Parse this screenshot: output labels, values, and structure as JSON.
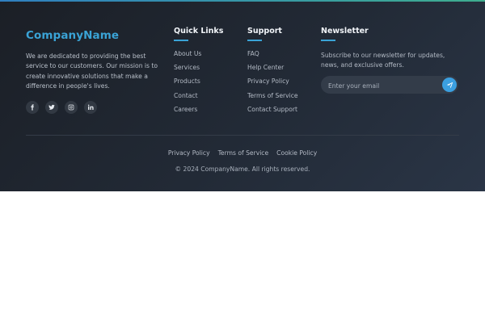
{
  "brand": {
    "name": "CompanyName",
    "description": "We are dedicated to providing the best service to our customers. Our mission is to create innovative solutions that make a difference in people's lives."
  },
  "socials": [
    {
      "icon": "facebook-icon",
      "glyph": "f"
    },
    {
      "icon": "twitter-icon",
      "glyph": "t"
    },
    {
      "icon": "instagram-icon",
      "glyph": "ig"
    },
    {
      "icon": "linkedin-icon",
      "glyph": "in"
    }
  ],
  "quick_links": {
    "title": "Quick Links",
    "items": [
      "About Us",
      "Services",
      "Products",
      "Contact",
      "Careers"
    ]
  },
  "support": {
    "title": "Support",
    "items": [
      "FAQ",
      "Help Center",
      "Privacy Policy",
      "Terms of Service",
      "Contact Support"
    ]
  },
  "newsletter": {
    "title": "Newsletter",
    "description": "Subscribe to our newsletter for updates, news, and exclusive offers.",
    "email_placeholder": "Enter your email",
    "email_value": "",
    "send_icon": "send-icon"
  },
  "legal": {
    "links": [
      "Privacy Policy",
      "Terms of Service",
      "Cookie Policy"
    ],
    "copyright": "© 2024 CompanyName. All rights reserved."
  },
  "colors": {
    "accent": "#3aa3d6",
    "button": "#3b9fe0",
    "footer_bg": "#1f252f"
  }
}
